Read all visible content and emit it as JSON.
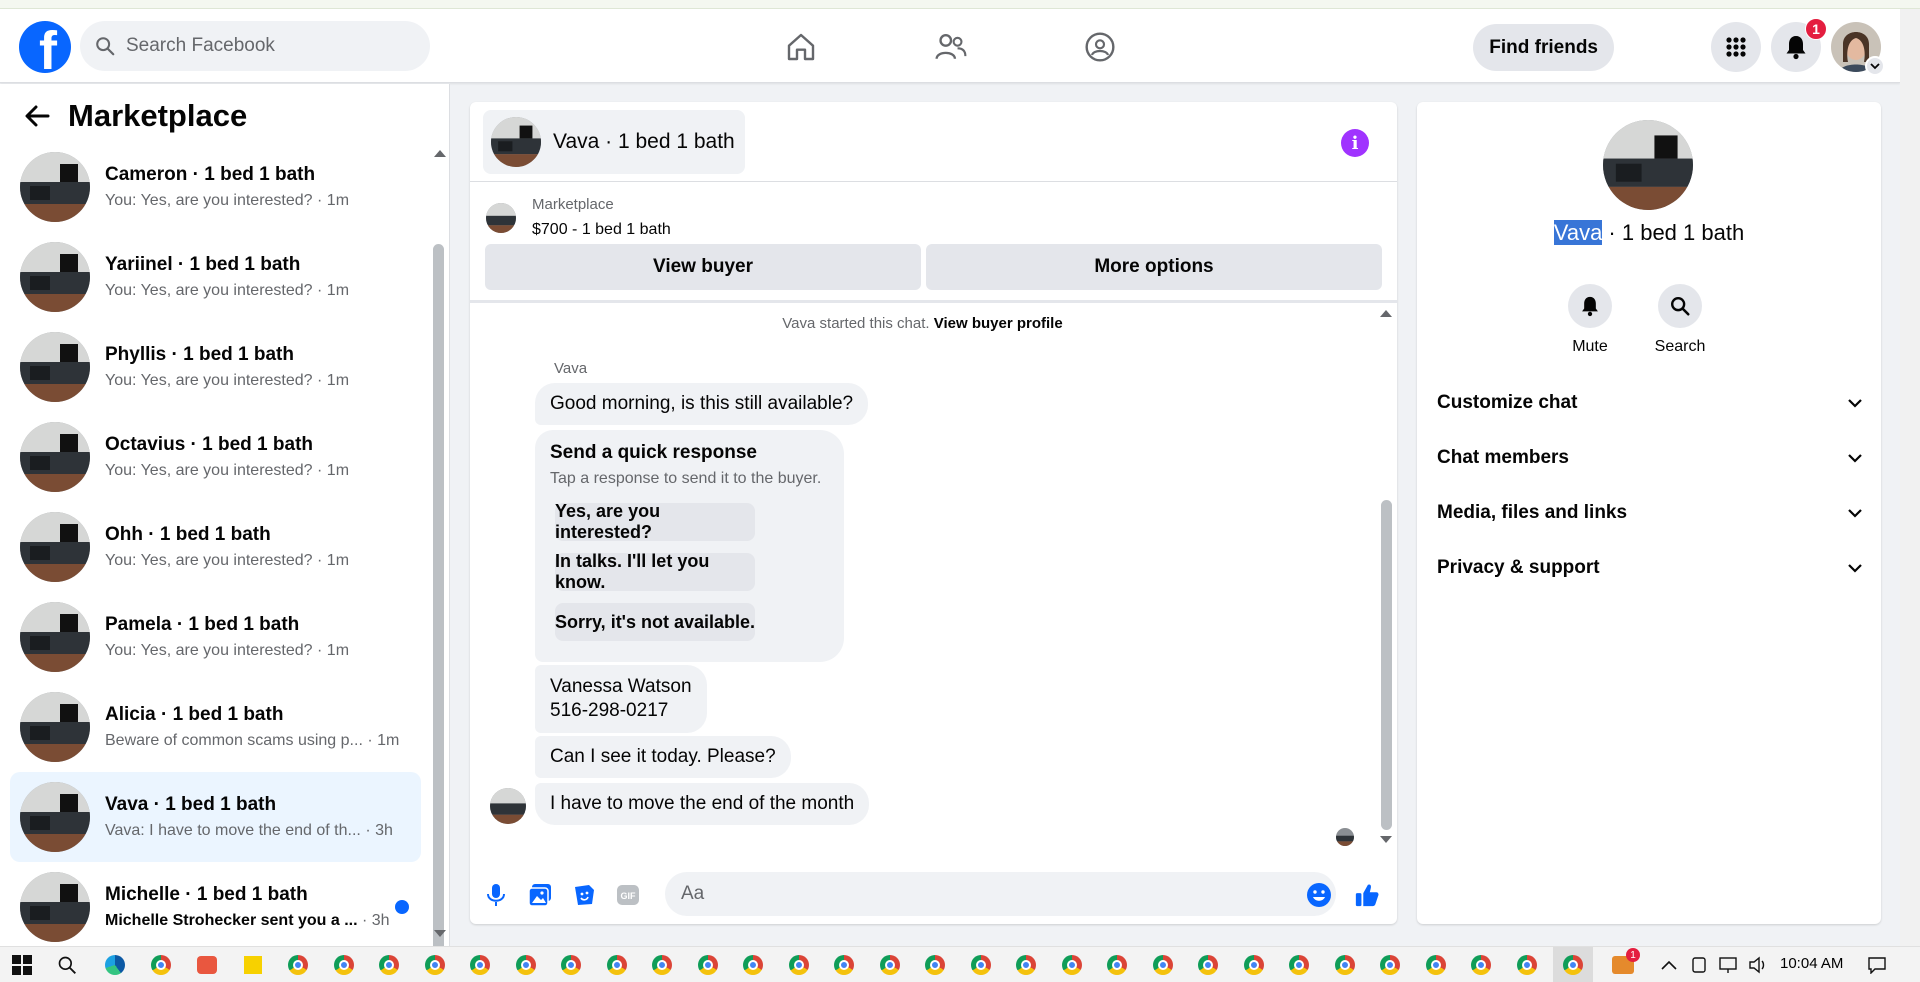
{
  "topbar": {
    "search_placeholder": "Search Facebook",
    "find_friends": "Find friends",
    "notifications_count": "1"
  },
  "sidebar": {
    "title": "Marketplace",
    "items": [
      {
        "name": "Cameron · 1 bed 1 bath",
        "preview": "You: Yes, are you interested?",
        "time": "· 1m"
      },
      {
        "name": "Yariinel · 1 bed 1 bath",
        "preview": "You: Yes, are you interested?",
        "time": "· 1m"
      },
      {
        "name": "Phyllis · 1 bed 1 bath",
        "preview": "You: Yes, are you interested?",
        "time": "· 1m"
      },
      {
        "name": "Octavius · 1 bed 1 bath",
        "preview": "You: Yes, are you interested?",
        "time": "· 1m"
      },
      {
        "name": "Ohh · 1 bed 1 bath",
        "preview": "You: Yes, are you interested?",
        "time": "· 1m"
      },
      {
        "name": "Pamela · 1 bed 1 bath",
        "preview": "You: Yes, are you interested?",
        "time": "· 1m"
      },
      {
        "name": "Alicia · 1 bed 1 bath",
        "preview": "Beware of common scams using p...",
        "time": "· 1m"
      },
      {
        "name": "Vava · 1 bed 1 bath",
        "preview": "Vava: I have to move the end of th...",
        "time": "· 3h"
      },
      {
        "name": "Michelle · 1 bed 1 bath",
        "preview": "Michelle Strohecker sent you a ...",
        "time": "· 3h"
      }
    ]
  },
  "chat": {
    "title": "Vava · 1 bed 1 bath",
    "listing_label": "Marketplace",
    "listing_price": "$700 - 1 bed 1 bath",
    "view_buyer": "View buyer",
    "more_options": "More options",
    "started_text": "Vava started this chat.",
    "view_buyer_profile": "View buyer profile",
    "sender": "Vava",
    "msg1": "Good morning, is this still available?",
    "quick_title": "Send a quick response",
    "quick_sub": "Tap a response to send it to the buyer.",
    "quick_options": [
      "Yes, are you interested?",
      "In talks. I'll let you know.",
      "Sorry, it's not available."
    ],
    "msg2_line1": "Vanessa Watson",
    "msg2_line2": "516-298-0217",
    "msg3": "Can I see it today. Please?",
    "msg4": "I have to move the end of the month",
    "composer_placeholder": "Aa",
    "gif_label": "GIF"
  },
  "details": {
    "title_highlight": "Vava",
    "title_rest": " · 1 bed 1 bath",
    "mute": "Mute",
    "search": "Search",
    "sections": [
      "Customize chat",
      "Chat members",
      "Media, files and links",
      "Privacy & support"
    ]
  },
  "taskbar": {
    "time": "10:04 AM",
    "badge": "1"
  },
  "colors": {
    "brand": "#0866ff",
    "info": "#a033ff",
    "active_row": "#ebf5ff",
    "highlight": "#3875d7"
  }
}
